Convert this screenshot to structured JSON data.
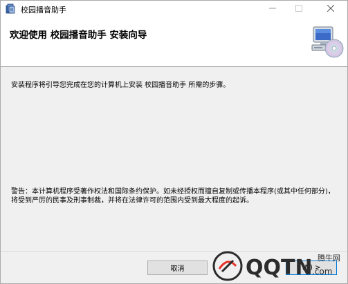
{
  "window": {
    "title": "校园播音助手",
    "controls": {
      "minimize": "—",
      "maximize": "☐",
      "close": "✕"
    }
  },
  "header": {
    "title": "欢迎使用 校园播音助手 安装向导"
  },
  "body": {
    "intro": "安装程序将引导您完成在您的计算机上安装 校园播音助手 所需的步骤。",
    "warning": "警告：本计算机程序受著作权法和国际条约保护。如未经授权而擅自复制或传播本程序(或其中任何部分)，将受到严厉的民事及刑事制裁，并将在法律许可的范围内受到最大程度的起诉。"
  },
  "footer": {
    "cancel_label": "取消",
    "next_label": "(N) >"
  },
  "watermark": {
    "brand": "QQTN",
    "suffix": ".com",
    "site": "腾牛网"
  },
  "colors": {
    "accent": "#0078d7",
    "watermark": "#2c2c2c",
    "watermark_accent": "#e8332a"
  }
}
